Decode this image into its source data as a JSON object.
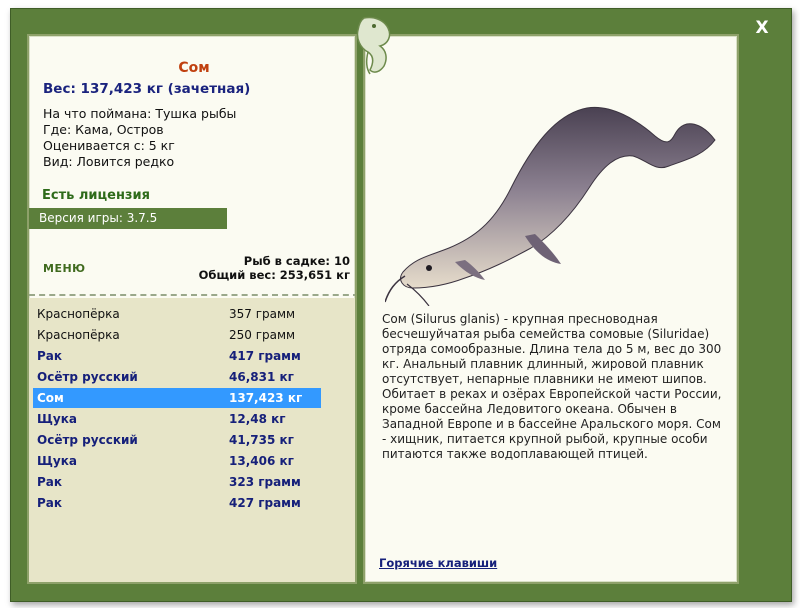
{
  "window": {
    "close_label": "X"
  },
  "fish": {
    "name": "Сом",
    "weight_line": "Вес: 137,423 кг (зачетная)",
    "info": [
      "На что поймана: Тушка рыбы",
      "Где: Кама, Остров",
      "Оценивается с: 5 кг",
      "Вид: Ловится редко"
    ]
  },
  "license": "Есть лицензия",
  "version": "Версия игры: 3.7.5",
  "menu_label": "МЕНЮ",
  "keepnet": {
    "count_line": "Рыб в садке: 10",
    "total_line": "Общий вес: 253,651 кг"
  },
  "catch_list": [
    {
      "name": "Краснопёрка",
      "weight": "357 грамм",
      "style": "normal"
    },
    {
      "name": "Краснопёрка",
      "weight": "250 грамм",
      "style": "normal"
    },
    {
      "name": "Рак",
      "weight": "417 грамм",
      "style": "bold"
    },
    {
      "name": "Осётр русский",
      "weight": "46,831 кг",
      "style": "bold"
    },
    {
      "name": "Сом",
      "weight": "137,423 кг",
      "style": "selected"
    },
    {
      "name": "Щука",
      "weight": "12,48 кг",
      "style": "bold"
    },
    {
      "name": "Осётр русский",
      "weight": "41,735 кг",
      "style": "bold"
    },
    {
      "name": "Щука",
      "weight": "13,406 кг",
      "style": "bold"
    },
    {
      "name": "Рак",
      "weight": "323 грамм",
      "style": "bold"
    },
    {
      "name": "Рак",
      "weight": "427 грамм",
      "style": "bold"
    }
  ],
  "description": "Сом (Silurus glanis) - крупная пресноводная бесчешуйчатая рыба семейства сомовые (Siluridae) отряда сомообразные. Длина тела до 5 м, вес до 300 кг. Анальный плавник длинный, жировой плавник отсутствует, непарные плавники не имеют шипов. Обитает в реках и озёрах Европейской части России, кроме бассейна Ледовитого океана. Обычен в Западной Европе и в бассейне Аральского моря. Сом - хищник, питается крупной рыбой, крупные особи питаются также водоплавающей птицей.",
  "hotkeys_label": "Горячие клавиши",
  "colors": {
    "frame": "#5c7f3b",
    "fish_name": "#c0400f",
    "weight": "#1a237e",
    "license": "#2e6b1a",
    "selection": "#3399ff",
    "list_bg": "#e7e5c8"
  },
  "icons": {
    "close": "close-icon",
    "emblem": "fish-emblem-icon"
  }
}
